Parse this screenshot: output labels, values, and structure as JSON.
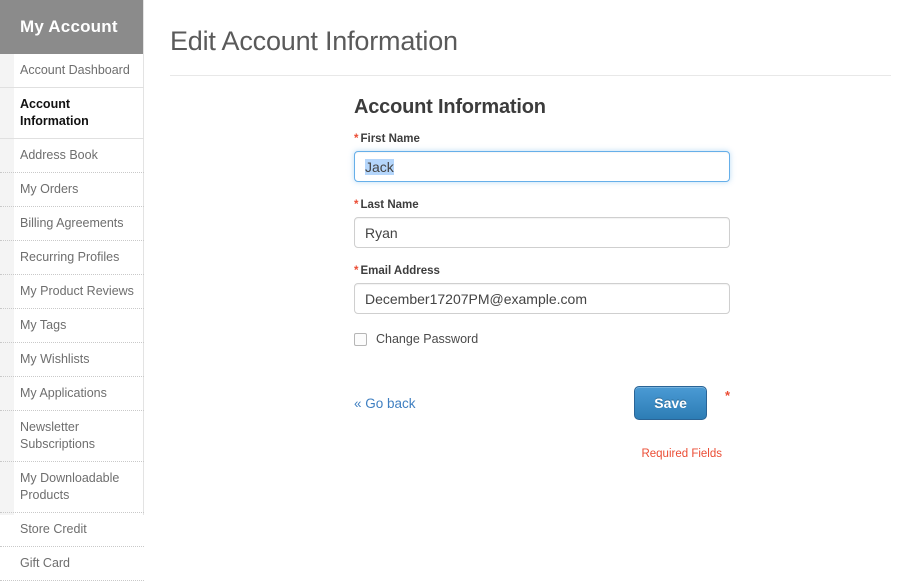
{
  "sidebar": {
    "header": "My Account",
    "items": [
      {
        "label": "Account Dashboard",
        "active": false,
        "solid_border": true
      },
      {
        "label": "Account Information",
        "active": true,
        "solid_border": true
      },
      {
        "label": "Address Book",
        "active": false,
        "solid_border": false
      },
      {
        "label": "My Orders",
        "active": false,
        "solid_border": false
      },
      {
        "label": "Billing Agreements",
        "active": false,
        "solid_border": false
      },
      {
        "label": "Recurring Profiles",
        "active": false,
        "solid_border": false
      },
      {
        "label": "My Product Reviews",
        "active": false,
        "solid_border": false
      },
      {
        "label": "My Tags",
        "active": false,
        "solid_border": false
      },
      {
        "label": "My Wishlists",
        "active": false,
        "solid_border": false
      },
      {
        "label": "My Applications",
        "active": false,
        "solid_border": false
      },
      {
        "label": "Newsletter Subscriptions",
        "active": false,
        "solid_border": false
      },
      {
        "label": "My Downloadable Products",
        "active": false,
        "solid_border": false
      },
      {
        "label": "Store Credit",
        "active": false,
        "solid_border": false
      },
      {
        "label": "Gift Card",
        "active": false,
        "solid_border": false
      }
    ]
  },
  "main": {
    "page_title": "Edit Account Information",
    "section_title": "Account Information",
    "fields": {
      "first_name": {
        "label": "First Name",
        "required_marker": "*",
        "value": "Jack",
        "placeholder": "",
        "focused": true,
        "selected": true
      },
      "last_name": {
        "label": "Last Name",
        "required_marker": "*",
        "value": "Ryan",
        "placeholder": "",
        "focused": false,
        "selected": false
      },
      "email": {
        "label": "Email Address",
        "required_marker": "*",
        "value": "December17207PM@example.com",
        "placeholder": "",
        "focused": false,
        "selected": false
      }
    },
    "change_password": {
      "label": "Change Password",
      "checked": false
    },
    "go_back_label": "« Go back",
    "save_label": "Save",
    "trailing_required_marker": "*",
    "required_note": "Required Fields"
  },
  "colors": {
    "sidebar_header_bg": "#8b8b8b",
    "required_red": "#eb4d35",
    "link_blue": "#3f7fc1",
    "button_blue_top": "#4a9ad4",
    "button_blue_bottom": "#2d7db5",
    "focus_border": "#66afe9",
    "selection_blue": "#b5d6fb"
  }
}
